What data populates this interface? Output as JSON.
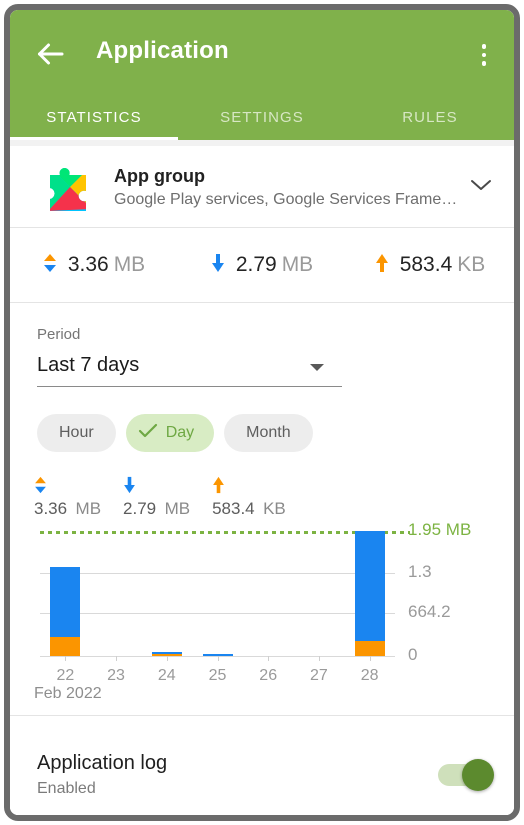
{
  "toolbar": {
    "back_icon": "arrow-left-icon",
    "title": "Application",
    "overflow_icon": "more-vertical-icon"
  },
  "tabs": [
    {
      "label": "STATISTICS",
      "active": true
    },
    {
      "label": "SETTINGS",
      "active": false
    },
    {
      "label": "RULES",
      "active": false
    }
  ],
  "app": {
    "icon": "google-play-services-icon",
    "name": "App group",
    "subtitle": "Google Play services, Google Services Frame…",
    "expand_icon": "chevron-down-icon"
  },
  "summary_top": [
    {
      "icon": "up-down-arrow-icon",
      "value": "3.36",
      "unit": "MB"
    },
    {
      "icon": "arrow-down-icon",
      "value": "2.79",
      "unit": "MB"
    },
    {
      "icon": "arrow-up-icon",
      "value": "583.4",
      "unit": "KB"
    }
  ],
  "period": {
    "label": "Period",
    "value": "Last 7 days",
    "caret_icon": "caret-down-icon"
  },
  "granularity": {
    "options": [
      {
        "label": "Hour",
        "selected": false
      },
      {
        "label": "Day",
        "selected": true
      },
      {
        "label": "Month",
        "selected": false
      }
    ],
    "check_icon": "check-icon"
  },
  "summary_chart": [
    {
      "icon": "up-down-arrow-icon",
      "value": "3.36",
      "unit": "MB"
    },
    {
      "icon": "arrow-down-icon",
      "value": "2.79",
      "unit": "MB"
    },
    {
      "icon": "arrow-up-icon",
      "value": "583.4",
      "unit": "KB"
    }
  ],
  "log": {
    "title": "Application log",
    "status": "Enabled",
    "toggle_on": true
  },
  "colors": {
    "toolbar_green": "#80b14b",
    "download_blue": "#1a85f0",
    "upload_orange": "#fb9500",
    "limit_green": "#7cb342",
    "chip_selected_bg": "#d8ecc4",
    "toggle_on": "#5c8a2e"
  },
  "chart_data": {
    "type": "bar",
    "stacked": true,
    "title": "",
    "xlabel": "Feb 2022",
    "ylabel": "",
    "categories": [
      "22",
      "23",
      "24",
      "25",
      "26",
      "27",
      "28"
    ],
    "series": [
      {
        "name": "Download",
        "color": "#1a85f0",
        "values": [
          1.09,
          0,
          0.012,
          0.022,
          0,
          0,
          1.72
        ]
      },
      {
        "name": "Upload",
        "color": "#fb9500",
        "values": [
          0.3,
          0,
          0.006,
          0,
          0,
          0,
          0.23
        ]
      }
    ],
    "totals": [
      1.39,
      0,
      0.018,
      0.022,
      0,
      0,
      1.95
    ],
    "unit": "MB",
    "ytick_labels": [
      "1.95 MB",
      "1.3",
      "664.2",
      "0"
    ],
    "ytick_values": [
      1.95,
      1.3,
      0.6642,
      0
    ],
    "ylim": [
      0,
      1.95
    ],
    "grid": true,
    "limit_line": {
      "label": "1.95 MB",
      "value": 1.95,
      "color": "#7cb342",
      "style": "dotted"
    },
    "axis_caption": "Feb 2022",
    "legend_position": "none"
  }
}
